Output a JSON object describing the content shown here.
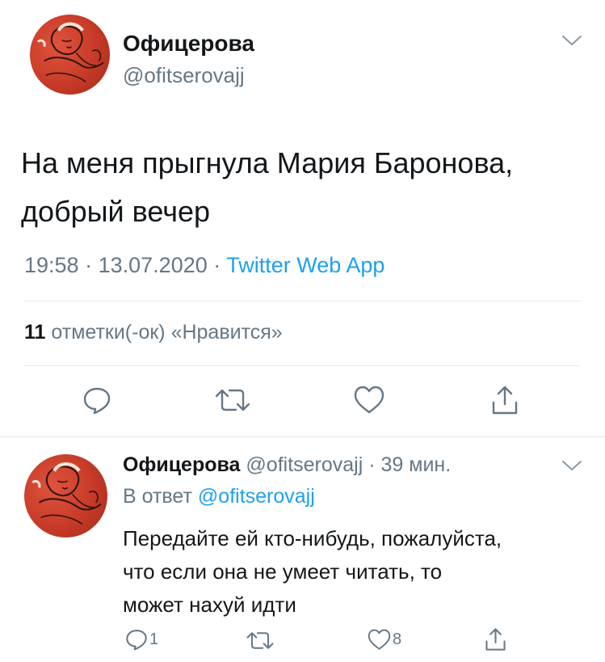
{
  "main_tweet": {
    "author_name": "Офицерова",
    "author_handle": "@ofitserovajj",
    "text_line1": "На меня прыгнула Мария Баронова,",
    "text_line2": "добрый вечер",
    "time": "19:58",
    "date": "13.07.2020",
    "separator": "·",
    "source": "Twitter Web App",
    "likes_count": "11",
    "likes_label": "отметки(-ок) «Нравится»"
  },
  "reply_tweet": {
    "author_name": "Офицерова",
    "author_handle": "@ofitserovajj",
    "separator": "·",
    "time_ago": "39 мин.",
    "reply_prefix": "В ответ",
    "reply_mention": "@ofitserovajj",
    "text_line1": "Передайте ей кто-нибудь, пожалуйста,",
    "text_line2": "что если она не умеет читать, то",
    "text_line3": "может нахуй идти",
    "reply_count": "1",
    "like_count": "8"
  },
  "icons": {
    "reply": "reply-bubble-icon",
    "retweet": "retweet-icon",
    "like": "heart-icon",
    "share": "share-icon",
    "menu": "chevron-down-icon"
  },
  "colors": {
    "link": "#1da1f2",
    "secondary": "#657786",
    "divider": "#e1e8ed",
    "avatar": "#c63a27"
  }
}
